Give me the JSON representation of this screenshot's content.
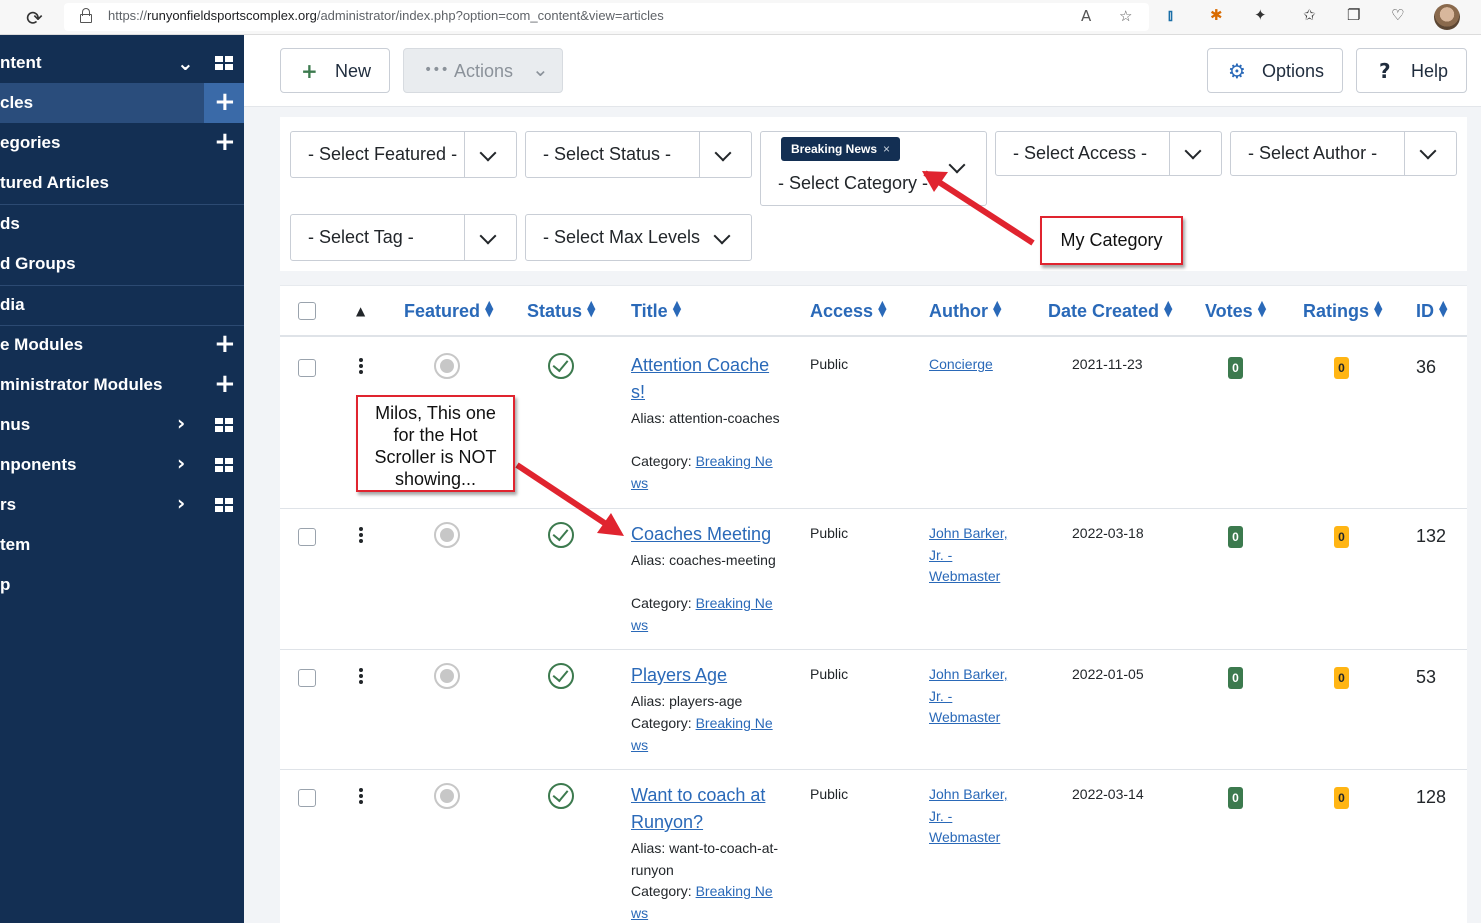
{
  "browser": {
    "url_prefix": "https://",
    "url_domain": "runyonfieldsportscomplex.org",
    "url_path": "/administrator/index.php?option=com_content&view=articles"
  },
  "sidebar": {
    "items": [
      {
        "label": "ntent"
      },
      {
        "label": "cles"
      },
      {
        "label": "egories"
      },
      {
        "label": "tured Articles"
      },
      {
        "label": "ds"
      },
      {
        "label": "d Groups"
      },
      {
        "label": "dia"
      },
      {
        "label": "e Modules"
      },
      {
        "label": "ministrator Modules"
      },
      {
        "label": "nus"
      },
      {
        "label": "nponents"
      },
      {
        "label": "rs"
      },
      {
        "label": "tem"
      },
      {
        "label": "p"
      }
    ]
  },
  "toolbar": {
    "new_label": "New",
    "actions_label": "Actions",
    "options_label": "Options",
    "help_label": "Help"
  },
  "filters": {
    "featured": "- Select Featured -",
    "status": "- Select Status -",
    "category_chip": "Breaking News",
    "category_chip_close": "×",
    "category": "- Select Category -",
    "access": "- Select Access -",
    "author": "- Select Author -",
    "tag": "- Select Tag -",
    "max_levels": "- Select Max Levels"
  },
  "table": {
    "columns": {
      "featured": "Featured",
      "status": "Status",
      "title": "Title",
      "access": "Access",
      "author": "Author",
      "date": "Date Created",
      "votes": "Votes",
      "ratings": "Ratings",
      "id": "ID"
    },
    "alias_prefix": "Alias: ",
    "category_prefix": "Category: ",
    "rows": [
      {
        "title": "Attention Coaches!",
        "alias": "attention-coaches",
        "category": "Breaking News",
        "access": "Public",
        "author": "Concierge",
        "date": "2021-11-23",
        "votes": "0",
        "ratings": "0",
        "id": "36"
      },
      {
        "title": "Coaches Meeting",
        "alias": "coaches-meeting",
        "category": "Breaking News",
        "access": "Public",
        "author": "John Barker, Jr. - Webmaster",
        "date": "2022-03-18",
        "votes": "0",
        "ratings": "0",
        "id": "132"
      },
      {
        "title": "Players Age",
        "alias": "players-age",
        "category": "Breaking News",
        "access": "Public",
        "author": "John Barker, Jr. - Webmaster",
        "date": "2022-01-05",
        "votes": "0",
        "ratings": "0",
        "id": "53"
      },
      {
        "title": "Want to coach at Runyon?",
        "alias": "want-to-coach-at-runyon",
        "category": "Breaking News",
        "access": "Public",
        "author": "John Barker, Jr. - Webmaster",
        "date": "2022-03-14",
        "votes": "0",
        "ratings": "0",
        "id": "128"
      }
    ]
  },
  "annotations": {
    "category_note": "My Category",
    "row_note": "Milos, This one for the Hot Scroller is NOT showing...",
    "color": "#e0242f"
  },
  "colors": {
    "sidebar": "#132f53",
    "link": "#2a69b8",
    "published": "#3c7a4e",
    "ratings": "#ffb514"
  }
}
